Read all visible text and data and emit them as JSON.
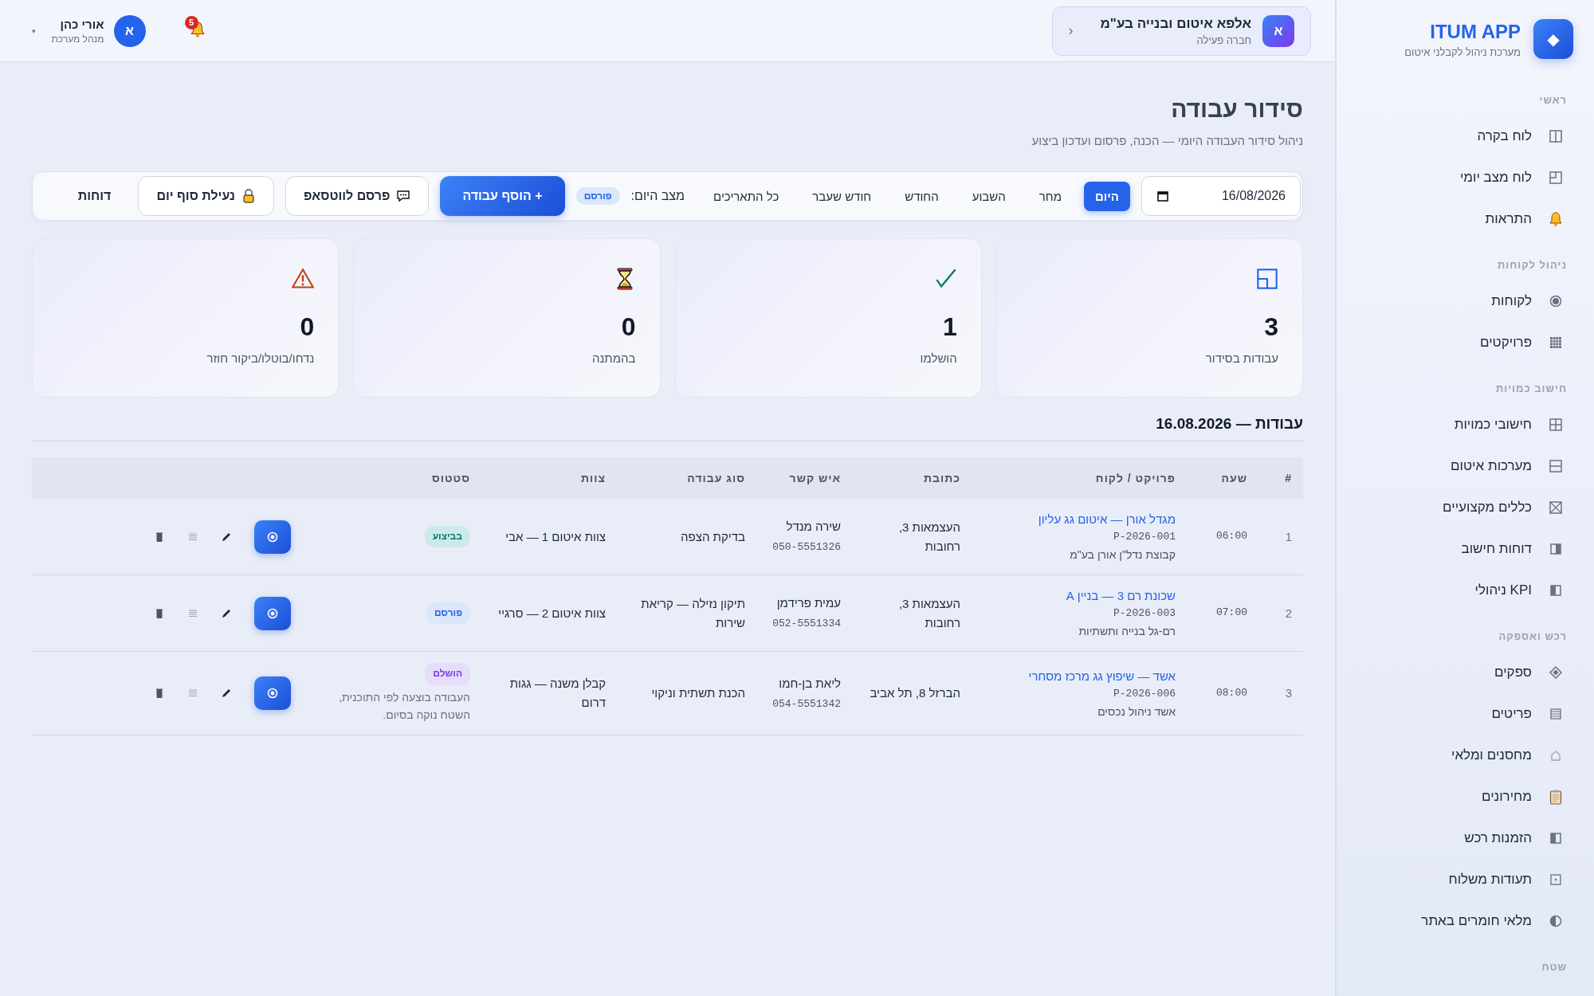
{
  "sidebar": {
    "logo_mark": "◆",
    "title": "ITUM APP",
    "subtitle": "מערכת ניהול לקבלני איטום",
    "sections": [
      {
        "title": "ראשי",
        "items": [
          {
            "label": "לוח בקרה"
          },
          {
            "label": "לוח מצב יומי"
          },
          {
            "label": "התראות"
          }
        ]
      },
      {
        "title": "ניהול לקוחות",
        "items": [
          {
            "label": "לקוחות"
          },
          {
            "label": "פרויקטים"
          }
        ]
      },
      {
        "title": "חישוב כמויות",
        "items": [
          {
            "label": "חישובי כמויות"
          },
          {
            "label": "מערכות איטום"
          },
          {
            "label": "כללים מקצועיים"
          },
          {
            "label": "דוחות חישוב"
          },
          {
            "label": "KPI ניהולי"
          }
        ]
      },
      {
        "title": "רכש ואספקה",
        "items": [
          {
            "label": "ספקים"
          },
          {
            "label": "פריטים"
          },
          {
            "label": "מחסנים ומלאי"
          },
          {
            "label": "מחירונים"
          },
          {
            "label": "הזמנות רכש"
          },
          {
            "label": "תעודות משלוח"
          },
          {
            "label": "מלאי חומרים באתר"
          }
        ]
      },
      {
        "title": "שטח"
      }
    ]
  },
  "topbar": {
    "company": {
      "avatar": "א",
      "name": "אלפא איטום ובנייה בע\"מ",
      "role": "חברה פעילה",
      "chevron": "‹"
    },
    "notifications": {
      "count": "5"
    },
    "user": {
      "avatar": "א",
      "name": "אורי כהן",
      "role": "מנהל מערכת",
      "caret": "▾"
    }
  },
  "page": {
    "title": "סידור עבודה",
    "subtitle": "ניהול סידור העבודה היומי — הכנה, פרסום ועדכון ביצוע"
  },
  "toolbar": {
    "date": "16/08/2026",
    "filters": [
      {
        "label": "היום",
        "selected": true
      },
      {
        "label": "מחר",
        "selected": false
      },
      {
        "label": "השבוע",
        "selected": false
      },
      {
        "label": "החודש",
        "selected": false
      },
      {
        "label": "חודש שעבר",
        "selected": false
      },
      {
        "label": "כל התאריכים",
        "selected": false
      }
    ],
    "day_status_label": "מצב היום:",
    "day_status": "פורסם",
    "buttons": [
      {
        "label": "+ הוסף עבודה",
        "kind": "primary"
      },
      {
        "label": "פרסם לווטסאפ",
        "kind": "whatsapp"
      },
      {
        "label": "נעילת סוף יום",
        "kind": "lock"
      },
      {
        "label": "דוחות",
        "kind": "plain"
      }
    ]
  },
  "stats": [
    {
      "value": "3",
      "label": "עבודות בסידור"
    },
    {
      "value": "1",
      "label": "הושלמו"
    },
    {
      "value": "0",
      "label": "בהמתנה"
    },
    {
      "value": "0",
      "label": "נדחו/בוטלו/ביקור חוזר"
    }
  ],
  "jobs": {
    "title": "עבודות — 16.08.2026",
    "columns": [
      "#",
      "שעה",
      "פרויקט / לקוח",
      "כתובת",
      "איש קשר",
      "סוג עבודה",
      "צוות",
      "סטטוס"
    ],
    "rows": [
      {
        "num": "1",
        "time": "06:00",
        "project": "מגדל אורן — איטום גג עליון",
        "code": "P-2026-001",
        "client": "קבוצת נדל\"ן אורן בע\"מ",
        "address": "העצמאות 3, רחובות",
        "contact": "שירה מנדל",
        "phone": "050-5551326",
        "type": "בדיקת הצפה",
        "team": "צוות איטום 1 — אבי",
        "status": {
          "label": "בביצוע",
          "kind": "in_progress"
        }
      },
      {
        "num": "2",
        "time": "07:00",
        "project": "שכונת רם 3 — בניין A",
        "code": "P-2026-003",
        "client": "רם-גל בנייה ותשתיות",
        "address": "העצמאות 3, רחובות",
        "contact": "עמית פרידמן",
        "phone": "052-5551334",
        "type": "תיקון נזילה — קריאת שירות",
        "team": "צוות איטום 2 — סרגיי",
        "status": {
          "label": "פורסם",
          "kind": "published"
        }
      },
      {
        "num": "3",
        "time": "08:00",
        "project": "אשד — שיפוץ גג מרכז מסחרי",
        "code": "P-2026-006",
        "client": "אשד ניהול נכסים",
        "address": "הברזל 8, תל אביב",
        "contact": "ליאת בן-חמו",
        "phone": "054-5551342",
        "type": "הכנת תשתית וניקוי",
        "team": "קבלן משנה — גגות דרום",
        "status": {
          "label": "הושלם",
          "kind": "done"
        },
        "note": "העבודה בוצעה לפי התוכנית, השטח נוקה בסיום."
      }
    ]
  }
}
